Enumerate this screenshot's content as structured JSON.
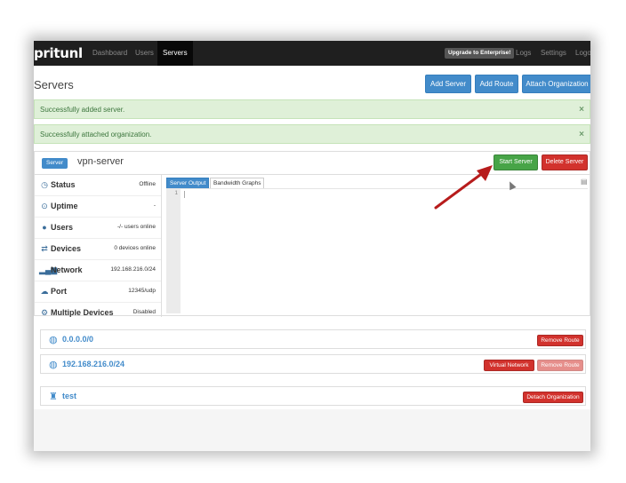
{
  "app": {
    "brand": "pritunl"
  },
  "navbar": {
    "items": [
      {
        "label": "Dashboard",
        "active": false
      },
      {
        "label": "Users",
        "active": false
      },
      {
        "label": "Servers",
        "active": true
      }
    ],
    "upgrade_label": "Upgrade to Enterprise!",
    "right_items": [
      "Logs",
      "Settings",
      "Logout"
    ]
  },
  "page": {
    "title": "Servers"
  },
  "header_buttons": {
    "add_server": "Add Server",
    "add_route": "Add Route",
    "attach_org": "Attach Organization"
  },
  "alerts": [
    {
      "text": "Successfully added server.",
      "close": "×"
    },
    {
      "text": "Successfully attached organization.",
      "close": "×"
    }
  ],
  "server": {
    "badge": "Server",
    "name": "vpn-server",
    "start_label": "Start Server",
    "delete_label": "Delete Server",
    "stats": [
      {
        "icon": "clock-icon",
        "label": "Status",
        "value": "Offline"
      },
      {
        "icon": "uptime-icon",
        "label": "Uptime",
        "value": "-"
      },
      {
        "icon": "user-icon",
        "label": "Users",
        "value": "-/- users online"
      },
      {
        "icon": "devices-icon",
        "label": "Devices",
        "value": "0 devices online"
      },
      {
        "icon": "signal-icon",
        "label": "Network",
        "value": "192.168.216.0/24"
      },
      {
        "icon": "cloud-upload-icon",
        "label": "Port",
        "value": "12345/udp"
      },
      {
        "icon": "gear-icon",
        "label": "Multiple Devices",
        "value": "Disabled"
      }
    ],
    "tabs": [
      "Server Output",
      "Bandwidth Graphs"
    ],
    "line_number": "1"
  },
  "routes": [
    {
      "network": "0.0.0.0/0",
      "remove_label": "Remove Route"
    },
    {
      "network": "192.168.216.0/24",
      "virtual_label": "Virtual Network",
      "remove_label": "Remove Route"
    }
  ],
  "organization": {
    "name": "test",
    "detach_label": "Detach Organization"
  },
  "colors": {
    "primary": "#428bca",
    "success": "#47a447",
    "danger": "#d2322d",
    "navbar": "#1f1f1f",
    "annotation_arrow": "#cc1f1f"
  }
}
